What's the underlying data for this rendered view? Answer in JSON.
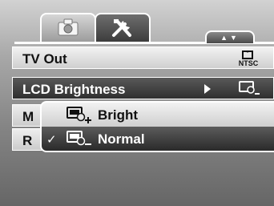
{
  "menu": {
    "tabs": [
      {
        "name": "camera",
        "icon": "camera-icon",
        "active": false
      },
      {
        "name": "setup",
        "icon": "setup-tools-icon",
        "active": true
      }
    ],
    "scroll_indicator": "▲▼",
    "items": [
      {
        "label": "TV Out",
        "value_icon": "ntsc-icon",
        "value_text": "NTSC"
      },
      {
        "label": "LCD Brightness",
        "value_icon": "lcd-brightness-normal-icon",
        "selected": true
      },
      {
        "label": "M"
      },
      {
        "label": "R"
      }
    ]
  },
  "submenu": {
    "options": [
      {
        "label": "Bright",
        "icon": "lcd-bright-icon",
        "checked": false
      },
      {
        "label": "Normal",
        "icon": "lcd-normal-icon",
        "checked": true
      }
    ],
    "check_mark": "✓"
  },
  "colors": {
    "highlight_dark": "#3a3a3a",
    "row_light": "#dedede",
    "frame": "#ffffff"
  }
}
